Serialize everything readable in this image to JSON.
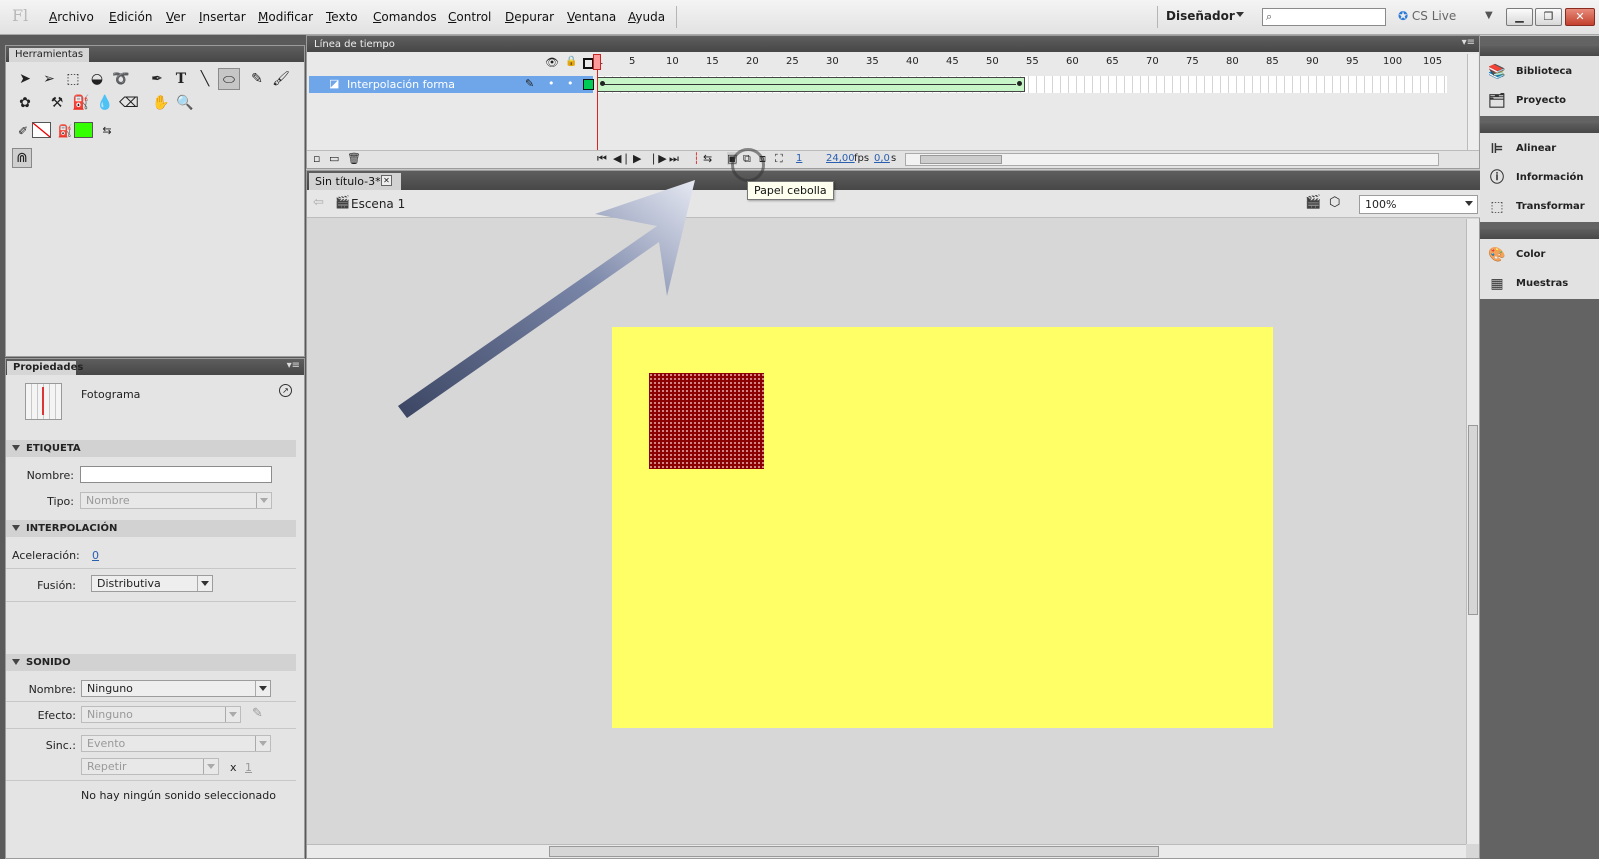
{
  "menubar": {
    "logo": "Fl",
    "items": [
      "Archivo",
      "Edición",
      "Ver",
      "Insertar",
      "Modificar",
      "Texto",
      "Comandos",
      "Control",
      "Depurar",
      "Ventana",
      "Ayuda"
    ],
    "workspace": "Diseñador",
    "cs_live": "CS Live"
  },
  "tools_panel": {
    "tab": "Herramientas"
  },
  "properties": {
    "tab": "Propiedades",
    "object_type": "Fotograma",
    "label_section": "ETIQUETA",
    "name_label": "Nombre:",
    "name_value": "",
    "type_label": "Tipo:",
    "type_value": "Nombre",
    "tween_section": "INTERPOLACIÓN",
    "ease_label": "Aceleración:",
    "ease_value": "0",
    "blend_label": "Fusión:",
    "blend_value": "Distributiva",
    "sound_section": "SONIDO",
    "sound_name_label": "Nombre:",
    "sound_name_value": "Ninguno",
    "effect_label": "Efecto:",
    "effect_value": "Ninguno",
    "sync_label": "Sinc.:",
    "sync_value": "Evento",
    "repeat_value": "Repetir",
    "repeat_x": "x",
    "repeat_count": "1",
    "no_sound": "No hay ningún sonido seleccionado"
  },
  "timeline": {
    "tab": "Línea de tiempo",
    "layer_name": "Interpolación forma",
    "frame_numbers": [
      "1",
      "5",
      "10",
      "15",
      "20",
      "25",
      "30",
      "35",
      "40",
      "45",
      "50",
      "55",
      "60",
      "65",
      "70",
      "75",
      "80",
      "85",
      "90",
      "95",
      "100",
      "105"
    ],
    "current_frame": "1",
    "fps": "24,00",
    "fps_unit": "fps",
    "time": "0,0",
    "time_unit": "s"
  },
  "document": {
    "tab": "Sin título-3*",
    "scene": "Escena 1",
    "zoom": "100%",
    "tooltip": "Papel cebolla"
  },
  "right_panels": {
    "group1": [
      "Biblioteca",
      "Proyecto"
    ],
    "group2": [
      "Alinear",
      "Información",
      "Transformar"
    ],
    "group3": [
      "Color",
      "Muestras"
    ]
  },
  "colors": {
    "stage": "#ffff66",
    "shape": "#8b0000",
    "layer_highlight": "#6ea6e9",
    "tween_span": "#c8f5c8"
  }
}
